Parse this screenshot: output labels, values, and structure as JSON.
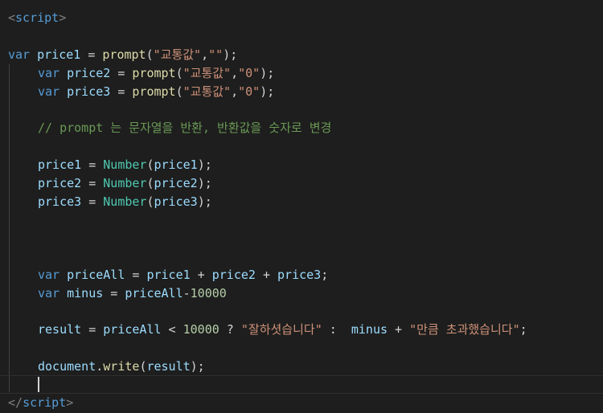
{
  "code": {
    "l1": {
      "lt": "<",
      "tag": "script",
      "gt": ">"
    },
    "l3": {
      "kw": "var",
      "name": "price1",
      "eq": " = ",
      "fn": "prompt",
      "open": "(",
      "s1": "\"교통값\"",
      "comma": ",",
      "s2": "\"\"",
      "close": ");"
    },
    "l4": {
      "kw": "var",
      "name": "price2",
      "eq": " = ",
      "fn": "prompt",
      "open": "(",
      "s1": "\"교통값\"",
      "comma": ",",
      "s2": "\"0\"",
      "close": ");"
    },
    "l5": {
      "kw": "var",
      "name": "price3",
      "eq": " = ",
      "fn": "prompt",
      "open": "(",
      "s1": "\"교통값\"",
      "comma": ",",
      "s2": "\"0\"",
      "close": ");"
    },
    "l7": {
      "comment": "// prompt 는 문자열을 반환, 반환값을 숫자로 변경"
    },
    "l9": {
      "name": "price1",
      "eq": " = ",
      "cls": "Number",
      "open": "(",
      "arg": "price1",
      "close": ");"
    },
    "l10": {
      "name": "price2",
      "eq": " = ",
      "cls": "Number",
      "open": "(",
      "arg": "price2",
      "close": ");"
    },
    "l11": {
      "name": "price3",
      "eq": " = ",
      "cls": "Number",
      "open": "(",
      "arg": "price3",
      "close": ");"
    },
    "l15": {
      "kw": "var",
      "name": "priceAll",
      "eq": " = ",
      "a": "price1",
      "p1": " + ",
      "b": "price2",
      "p2": " + ",
      "c": "price3",
      "end": ";"
    },
    "l16": {
      "kw": "var",
      "name": "minus",
      "eq": " = ",
      "a": "priceAll",
      "op": "-",
      "num": "10000"
    },
    "l18": {
      "name": "result",
      "eq": " = ",
      "a": "priceAll",
      "lt": " < ",
      "num": "10000",
      "q": " ? ",
      "s1": "\"잘하셧습니다\"",
      "colon": " :  ",
      "b": "minus",
      "plus": " + ",
      "s2": "\"만큼 초과했습니다\"",
      "end": ";"
    },
    "l20": {
      "obj": "document",
      "dot": ".",
      "fn": "write",
      "open": "(",
      "arg": "result",
      "close": ");"
    },
    "l22": {
      "lt": "</",
      "tag": "script",
      "gt": ">"
    }
  }
}
